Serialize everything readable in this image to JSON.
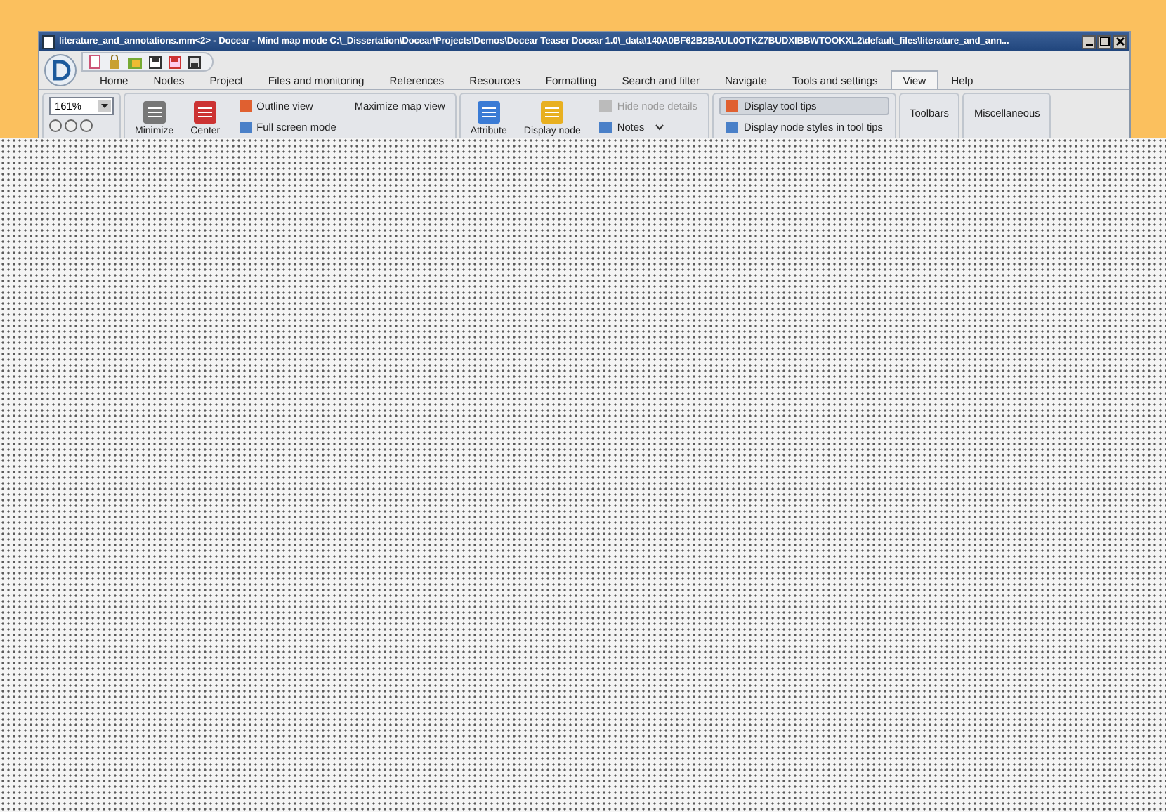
{
  "window": {
    "title": "literature_and_annotations.mm<2> - Docear - Mind map mode C:\\_Dissertation\\Docear\\Projects\\Demos\\Docear Teaser Docear 1.0\\_data\\140A0BF62B2BAUL0OTKZ7BUDXIBBWTOOKXL2\\default_files\\literature_and_ann..."
  },
  "tabs": [
    {
      "label": "Home",
      "selected": false
    },
    {
      "label": "Nodes",
      "selected": false
    },
    {
      "label": "Project",
      "selected": false
    },
    {
      "label": "Files and monitoring",
      "selected": false
    },
    {
      "label": "References",
      "selected": false
    },
    {
      "label": "Resources",
      "selected": false
    },
    {
      "label": "Formatting",
      "selected": false
    },
    {
      "label": "Search and filter",
      "selected": false
    },
    {
      "label": "Navigate",
      "selected": false
    },
    {
      "label": "Tools and settings",
      "selected": false
    },
    {
      "label": "View",
      "selected": true
    },
    {
      "label": "Help",
      "selected": false
    }
  ],
  "zoom": {
    "value": "161%"
  },
  "groups": [
    {
      "items": [
        {
          "kind": "large",
          "label": "Minimize"
        },
        {
          "kind": "large",
          "label": "Center"
        },
        {
          "kind": "column",
          "items": [
            {
              "label": "Outline view",
              "selected": false,
              "disabled": false
            },
            {
              "label": "Full screen mode",
              "selected": false,
              "disabled": false
            }
          ]
        },
        {
          "kind": "plain",
          "label": "Maximize map view"
        }
      ]
    },
    {
      "items": [
        {
          "kind": "large",
          "label": "Attribute"
        },
        {
          "kind": "large",
          "label": "Display node"
        },
        {
          "kind": "column",
          "items": [
            {
              "label": "Hide node details",
              "selected": false,
              "disabled": true
            },
            {
              "label": "Notes",
              "selected": false,
              "disabled": false,
              "dropdown": true
            }
          ]
        }
      ]
    },
    {
      "items": [
        {
          "kind": "column",
          "items": [
            {
              "label": "Display tool tips",
              "selected": true,
              "disabled": false
            },
            {
              "label": "Display node styles in tool tips",
              "selected": false,
              "disabled": false
            }
          ]
        }
      ]
    },
    {
      "items": [
        {
          "kind": "group",
          "label": "Toolbars"
        }
      ]
    },
    {
      "items": [
        {
          "kind": "group",
          "label": "Miscellaneous"
        }
      ]
    }
  ]
}
